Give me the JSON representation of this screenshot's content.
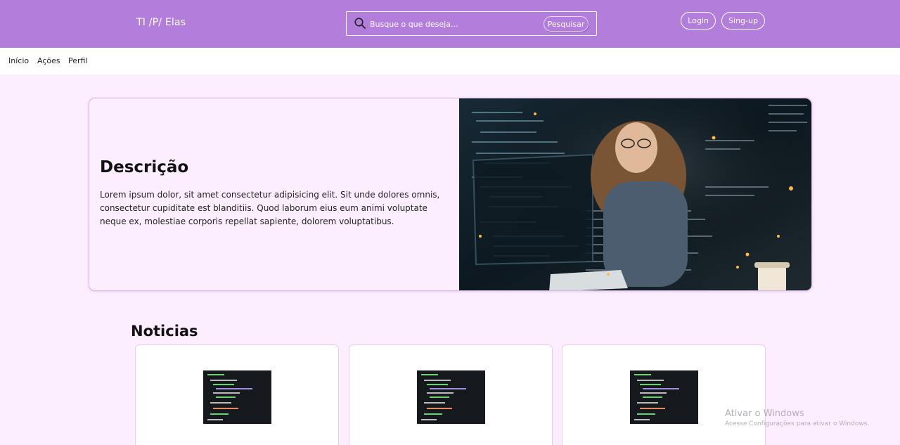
{
  "header": {
    "brand": "TI /P/ Elas",
    "search": {
      "placeholder": "Busque o que deseja...",
      "button_label": "Pesquisar",
      "icon": "search-icon"
    },
    "login_label": "Login",
    "signup_label": "Sing-up"
  },
  "nav": {
    "items": [
      "Início",
      "Ações",
      "Perfil"
    ]
  },
  "hero": {
    "title": "Descrição",
    "text": "Lorem ipsum dolor, sit amet consectetur adipisicing elit. Sit unde dolores omnis, consectetur cupiditate est blanditiis. Quod laborum eius eum animi voluptate neque ex, molestiae corporis repellat sapiente, dolorem voluptatibus."
  },
  "news": {
    "title": "Noticias",
    "cards": 3
  },
  "watermark": {
    "title": "Ativar o Windows",
    "subtitle": "Acesse Configurações para ativar o Windows."
  },
  "colors": {
    "header": "#b37edb",
    "page_bg": "#fdeeff",
    "card_border": "#d8b6e6"
  }
}
